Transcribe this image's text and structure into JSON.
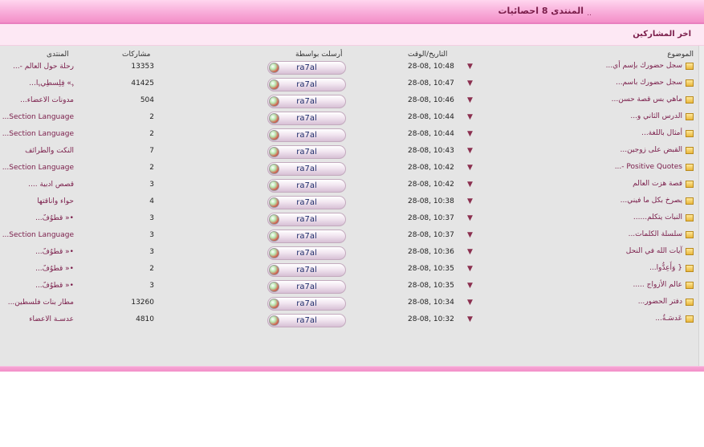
{
  "header": {
    "title": "المنتدى 8 احصائيات",
    "dots": ".."
  },
  "section": {
    "title": "اخر المشاركين"
  },
  "columns": {
    "topic": "الموضوع",
    "date": "التاريخ/الوقت",
    "sent_by": "أرسلت بواسطة",
    "posts": "مشاركات",
    "forum": "المنتدى"
  },
  "rows": [
    {
      "topic": "سجل حضورك بإسم أي...",
      "date": "28-08, 10:48",
      "user": "ra7al",
      "posts": "13353",
      "forum": "رحلة حول العالم -..."
    },
    {
      "topic": "سجل حضورك باسم...",
      "date": "28-08, 10:47",
      "user": "ra7al",
      "posts": "41425",
      "forum": "ﮩ» فِلِسطِيﮩا..."
    },
    {
      "topic": "ماهي بس قصة حسن...",
      "date": "28-08, 10:46",
      "user": "ra7al",
      "posts": "504",
      "forum": "مدونات الأعضاء..."
    },
    {
      "topic": "الدرس الثاني و...",
      "date": "28-08, 10:44",
      "user": "ra7al",
      "posts": "2",
      "forum": "Section Language..."
    },
    {
      "topic": "أمثال باللغة...",
      "date": "28-08, 10:44",
      "user": "ra7al",
      "posts": "2",
      "forum": "Section Language..."
    },
    {
      "topic": "القبض على زوجين...",
      "date": "28-08, 10:43",
      "user": "ra7al",
      "posts": "7",
      "forum": "النكت والطرائف"
    },
    {
      "topic": "Positive Quotes -...",
      "date": "28-08, 10:42",
      "user": "ra7al",
      "posts": "2",
      "forum": "Section Language..."
    },
    {
      "topic": "قصة هزت العالم",
      "date": "28-08, 10:42",
      "user": "ra7al",
      "posts": "3",
      "forum": "قصص أدبية ...."
    },
    {
      "topic": "يصرخ بكل ما فيني...",
      "date": "28-08, 10:38",
      "user": "ra7al",
      "posts": "4",
      "forum": "حواء وأناقتها"
    },
    {
      "topic": "النبات يتكلم......",
      "date": "28-08, 10:37",
      "user": "ra7al",
      "posts": "3",
      "forum": "•« قطوٌفٌ..."
    },
    {
      "topic": "سلسلة الكلمات...",
      "date": "28-08, 10:37",
      "user": "ra7al",
      "posts": "3",
      "forum": "Section Language..."
    },
    {
      "topic": "آيات الله في النحل",
      "date": "28-08, 10:36",
      "user": "ra7al",
      "posts": "3",
      "forum": "•« قطوٌفٌ..."
    },
    {
      "topic": "{ وَأَعِدُّوا...",
      "date": "28-08, 10:35",
      "user": "ra7al",
      "posts": "2",
      "forum": "•« قطوٌفٌ..."
    },
    {
      "topic": "عالم الأزواج .....",
      "date": "28-08, 10:35",
      "user": "ra7al",
      "posts": "3",
      "forum": "•« قطوٌفٌ..."
    },
    {
      "topic": "دفتر الحضور...",
      "date": "28-08, 10:34",
      "user": "ra7al",
      "posts": "13260",
      "forum": "مطار بنات فلسطين..."
    },
    {
      "topic": "عَدسَـةُ...",
      "date": "28-08, 10:32",
      "user": "ra7al",
      "posts": "4810",
      "forum": "عدسـة الأعضاء"
    }
  ]
}
